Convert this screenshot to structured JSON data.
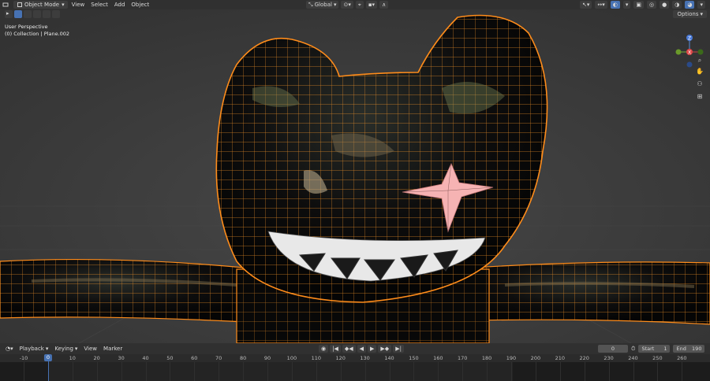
{
  "header": {
    "mode": "Object Mode",
    "menus": [
      "View",
      "Select",
      "Add",
      "Object"
    ],
    "transform_orientation": "Global",
    "options_label": "Options"
  },
  "viewport": {
    "perspective_label": "User Perspective",
    "collection_label": "(0) Collection | Plane.002",
    "gizmo_axes": [
      "Z",
      "X",
      "Y"
    ]
  },
  "timeline": {
    "menus": [
      "Playback",
      "Keying",
      "View",
      "Marker"
    ],
    "current_frame": "0",
    "start_label": "Start",
    "start_value": "1",
    "end_label": "End",
    "end_value": "190",
    "ruler_ticks": [
      "-10",
      "0",
      "10",
      "20",
      "30",
      "40",
      "50",
      "60",
      "70",
      "80",
      "90",
      "100",
      "110",
      "120",
      "130",
      "140",
      "150",
      "160",
      "170",
      "180",
      "190",
      "200",
      "210",
      "220",
      "230",
      "240",
      "250",
      "260"
    ],
    "playhead_label": "0"
  },
  "colors": {
    "accent": "#4772b3",
    "selection_outline": "#ff8c1a",
    "star_fill": "#f6b3b3"
  }
}
